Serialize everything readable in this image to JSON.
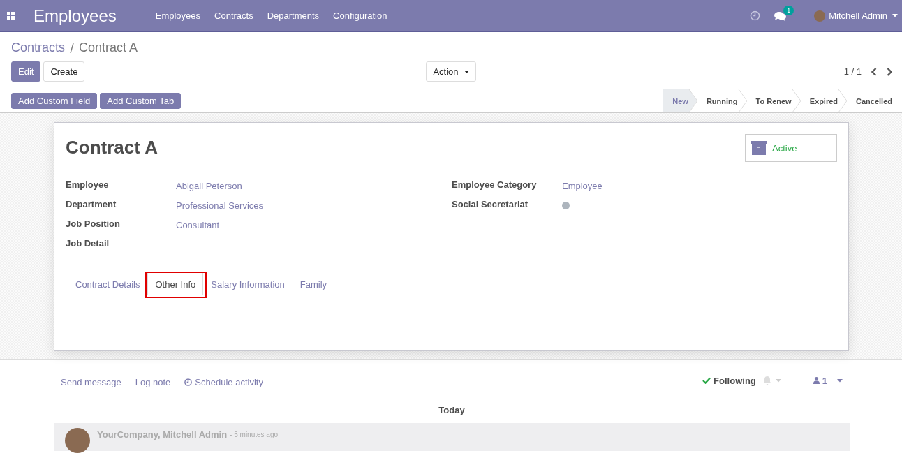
{
  "app": {
    "title": "Employees",
    "menu": [
      "Employees",
      "Contracts",
      "Departments",
      "Configuration"
    ],
    "message_count": "1",
    "user": "Mitchell Admin"
  },
  "breadcrumb": [
    {
      "label": "Contracts",
      "kind": "link"
    },
    {
      "label": "Contract A",
      "kind": "current"
    }
  ],
  "buttons": [
    {
      "label": "Edit",
      "kind": "primary"
    },
    {
      "label": "Create",
      "kind": "secondary"
    }
  ],
  "action_menu": "Action",
  "pager": "1 / 1",
  "custom_buttons": [
    "Add Custom Field",
    "Add Custom Tab"
  ],
  "stages": [
    {
      "label": "New",
      "selected": true
    },
    {
      "label": "Running",
      "selected": false
    },
    {
      "label": "To Renew",
      "selected": false
    },
    {
      "label": "Expired",
      "selected": false
    },
    {
      "label": "Cancelled",
      "selected": false
    }
  ],
  "record": {
    "title": "Contract A",
    "status_button": "Active",
    "left_fields": [
      {
        "label": "Employee",
        "value": "Abigail Peterson"
      },
      {
        "label": "Department",
        "value": "Professional Services"
      },
      {
        "label": "Job Position",
        "value": "Consultant"
      },
      {
        "label": "Job Detail"
      }
    ],
    "right_fields": [
      {
        "label": "Employee Category",
        "kind": "link",
        "value": "Employee"
      },
      {
        "label": "Social Secretariat",
        "kind": "dot"
      }
    ],
    "tabs": [
      {
        "label": "Contract Details",
        "selected": false,
        "highlighted": false
      },
      {
        "label": "Other Info",
        "selected": true,
        "highlighted": true
      },
      {
        "label": "Salary Information",
        "selected": false,
        "highlighted": false
      },
      {
        "label": "Family",
        "selected": false,
        "highlighted": false
      }
    ]
  },
  "chatter": {
    "actions": [
      {
        "label": "Send message",
        "kind": "text"
      },
      {
        "label": "Log note",
        "kind": "text"
      },
      {
        "label": "Schedule activity",
        "kind": "activity"
      }
    ],
    "following": "Following",
    "followers": "1",
    "divider": "Today",
    "message": {
      "author": "YourCompany, Mitchell Admin",
      "time": "- 5 minutes ago"
    }
  }
}
